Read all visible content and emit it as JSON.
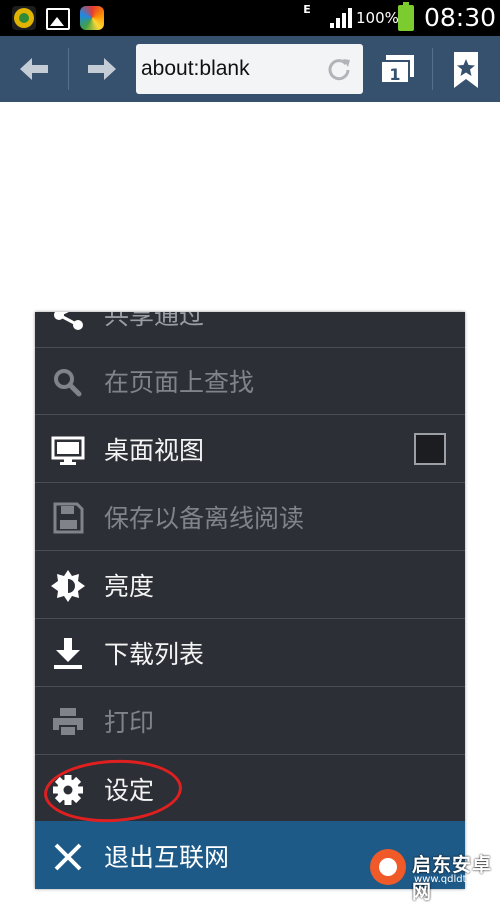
{
  "status_bar": {
    "network": "E",
    "battery": "100%",
    "time": "08:30"
  },
  "toolbar": {
    "url": "about:blank",
    "tab_count": "1"
  },
  "menu": {
    "items": [
      {
        "label": "共享通过",
        "icon": "share-icon",
        "enabled": true
      },
      {
        "label": "在页面上查找",
        "icon": "search-icon",
        "enabled": false
      },
      {
        "label": "桌面视图",
        "icon": "monitor-icon",
        "enabled": true,
        "checked": false
      },
      {
        "label": "保存以备离线阅读",
        "icon": "save-icon",
        "enabled": false
      },
      {
        "label": "亮度",
        "icon": "brightness-icon",
        "enabled": true
      },
      {
        "label": "下载列表",
        "icon": "download-icon",
        "enabled": true
      },
      {
        "label": "打印",
        "icon": "print-icon",
        "enabled": false
      },
      {
        "label": "设定",
        "icon": "gear-icon",
        "enabled": true,
        "highlighted": true
      },
      {
        "label": "退出互联网",
        "icon": "close-icon",
        "enabled": true
      }
    ]
  },
  "watermark": {
    "name": "启东安卓网",
    "url": "www.qdldtcs.com"
  }
}
